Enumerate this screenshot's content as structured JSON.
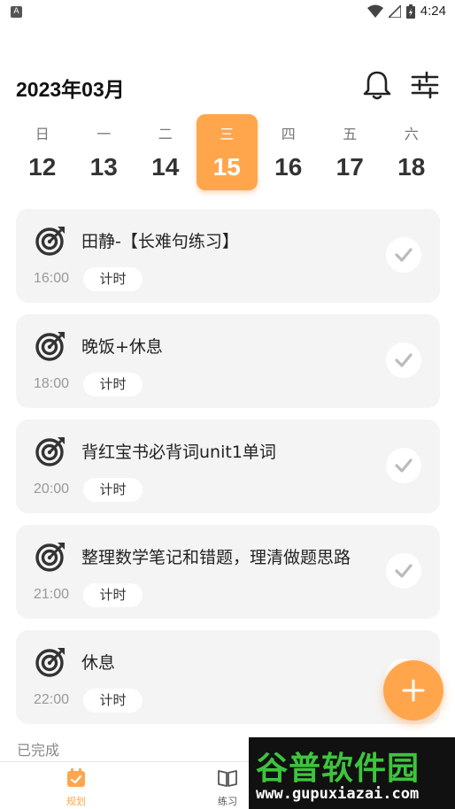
{
  "status_bar": {
    "app_icon_letter": "A",
    "time": "4:24"
  },
  "header": {
    "month_title": "2023年03月"
  },
  "week": {
    "selected_index": 3,
    "days": [
      {
        "weekday": "日",
        "date": "12"
      },
      {
        "weekday": "一",
        "date": "13"
      },
      {
        "weekday": "二",
        "date": "14"
      },
      {
        "weekday": "三",
        "date": "15"
      },
      {
        "weekday": "四",
        "date": "16"
      },
      {
        "weekday": "五",
        "date": "17"
      },
      {
        "weekday": "六",
        "date": "18"
      }
    ]
  },
  "tasks": [
    {
      "title": "田静-【长难句练习】",
      "time": "16:00",
      "timer_label": "计时"
    },
    {
      "title": "晚饭+休息",
      "time": "18:00",
      "timer_label": "计时"
    },
    {
      "title": "背红宝书必背词unit1单词",
      "time": "20:00",
      "timer_label": "计时"
    },
    {
      "title": "整理数学笔记和错题，理清做题思路",
      "time": "21:00",
      "timer_label": "计时"
    },
    {
      "title": "休息",
      "time": "22:00",
      "timer_label": "计时"
    }
  ],
  "completed_label": "已完成",
  "bottom_nav": {
    "plan_label": "规划",
    "practice_label": "练习"
  },
  "watermark": {
    "main": "谷普软件园",
    "sub": "www.gupuxiazai.com"
  },
  "colors": {
    "accent": "#ffa64d",
    "card_bg": "#f4f4f4"
  },
  "icons": {
    "bell": "bell-icon",
    "filter": "sliders-icon",
    "task": "target-icon",
    "check": "check-icon",
    "fab": "plus-icon"
  }
}
